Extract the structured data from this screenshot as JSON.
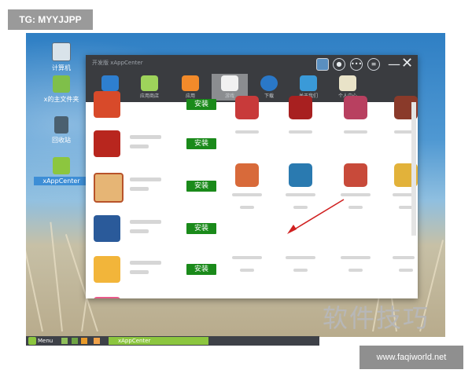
{
  "watermark_top": "TG: MYYJJPP",
  "brand_watermark": "软件技巧",
  "site_watermark": "www.faqiworld.net",
  "desktop_icons": [
    {
      "label": "计算机"
    },
    {
      "label": "x的主文件夹"
    },
    {
      "label": "回收站"
    },
    {
      "label": "xAppCenter"
    }
  ],
  "taskbar": {
    "menu_label": "Menu",
    "app_label": "xAppCenter"
  },
  "window": {
    "title": "开发版 xAppCenter",
    "tabs": [
      {
        "label": "已安装"
      },
      {
        "label": "应用商店"
      },
      {
        "label": "应用"
      },
      {
        "label": "游戏"
      },
      {
        "label": "下载"
      },
      {
        "label": "关于我们"
      },
      {
        "label": "个人中心"
      }
    ],
    "install_label": "安装"
  },
  "colors": {
    "install_green": "#1a8a1a",
    "titlebar": "#3a3c40",
    "active_tab": "#8b8d90"
  }
}
